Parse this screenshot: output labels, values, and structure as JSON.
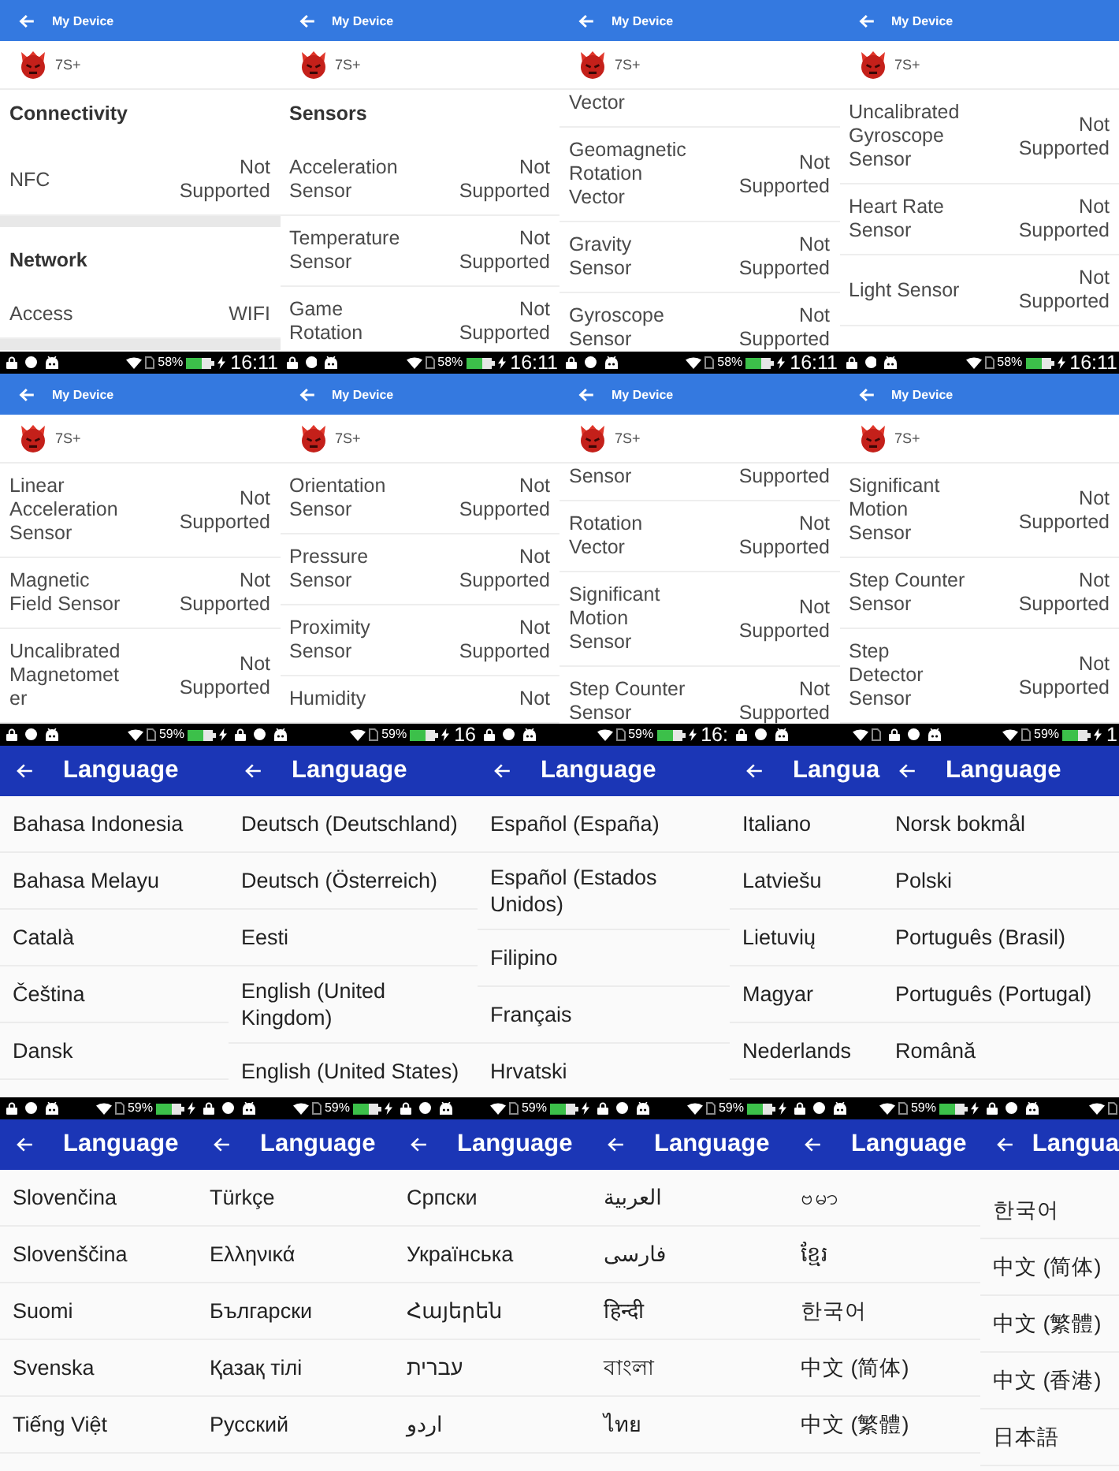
{
  "strips": [
    {
      "screens": [
        {
          "kind": "device",
          "header": {
            "title": "My Device"
          },
          "device": {
            "name": "7S+"
          },
          "entries": [
            {
              "kind": "heading",
              "text": "Connectivity"
            },
            {
              "kind": "row",
              "label": "NFC",
              "value": "Not Supported"
            },
            {
              "kind": "gap"
            },
            {
              "kind": "heading",
              "text": "Network"
            },
            {
              "kind": "row",
              "label": "Access",
              "value": "WIFI"
            },
            {
              "kind": "gap"
            }
          ],
          "status_bar": {
            "battery": "58%",
            "time": "16:11"
          }
        },
        {
          "kind": "device",
          "header": {
            "title": "My Device"
          },
          "device": {
            "name": "7S+"
          },
          "entries": [
            {
              "kind": "heading",
              "text": "Sensors"
            },
            {
              "kind": "row",
              "label": "Acceleration Sensor",
              "value": "Not Supported"
            },
            {
              "kind": "row",
              "label": "Temperature Sensor",
              "value": "Not Supported"
            },
            {
              "kind": "row",
              "label": "Game Rotation",
              "value": "Not Supported"
            }
          ],
          "status_bar": {
            "battery": "58%",
            "time": "16:11"
          }
        },
        {
          "kind": "device",
          "header": {
            "title": "My Device"
          },
          "device": {
            "name": "7S+"
          },
          "entries": [
            {
              "kind": "row",
              "label": "Vector"
            },
            {
              "kind": "row",
              "label": "Geomagnetic Rotation Vector",
              "value": "Not Supported"
            },
            {
              "kind": "row",
              "label": "Gravity Sensor",
              "value": "Not Supported"
            },
            {
              "kind": "row",
              "label": "Gyroscope Sensor",
              "value": "Not Supported"
            }
          ],
          "status_bar": {
            "battery": "58%",
            "time": "16:11"
          }
        },
        {
          "kind": "device",
          "header": {
            "title": "My Device"
          },
          "device": {
            "name": "7S+"
          },
          "entries": [
            {
              "kind": "row",
              "label": "Uncalibrated Gyroscope Sensor",
              "value": "Not Supported"
            },
            {
              "kind": "row",
              "label": "Heart Rate Sensor",
              "value": "Not Supported"
            },
            {
              "kind": "row",
              "label": "Light Sensor",
              "value": "Not Supported"
            }
          ],
          "status_bar": {
            "battery": "58%",
            "time": "16:11"
          }
        }
      ]
    },
    {
      "screens": [
        {
          "kind": "device",
          "header": {
            "title": "My Device"
          },
          "device": {
            "name": "7S+"
          },
          "entries": [
            {
              "kind": "row",
              "label": "Linear Acceleration Sensor",
              "value": "Not Supported"
            },
            {
              "kind": "row",
              "label": "Magnetic Field Sensor",
              "value": "Not Supported"
            },
            {
              "kind": "row",
              "label": "Uncalibrated Magnetometer",
              "value": "Not Supported"
            }
          ]
        },
        {
          "kind": "device",
          "header": {
            "title": "My Device"
          },
          "device": {
            "name": "7S+"
          },
          "entries": [
            {
              "kind": "row",
              "label": "Orientation Sensor",
              "value": "Not Supported"
            },
            {
              "kind": "row",
              "label": "Pressure Sensor",
              "value": "Not Supported"
            },
            {
              "kind": "row",
              "label": "Proximity Sensor",
              "value": "Not Supported"
            },
            {
              "kind": "row",
              "label": "Humidity",
              "value": "Not"
            }
          ]
        },
        {
          "kind": "device",
          "header": {
            "title": "My Device"
          },
          "device": {
            "name": "7S+"
          },
          "entries": [
            {
              "kind": "row",
              "label": "Sensor",
              "value": "Supported"
            },
            {
              "kind": "row",
              "label": "Rotation Vector",
              "value": "Not Supported"
            },
            {
              "kind": "row",
              "label": "Significant Motion Sensor",
              "value": "Not Supported"
            },
            {
              "kind": "row",
              "label": "Step Counter Sensor",
              "value": "Not Supported"
            }
          ]
        },
        {
          "kind": "device",
          "header": {
            "title": "My Device"
          },
          "device": {
            "name": "7S+"
          },
          "entries": [
            {
              "kind": "row",
              "label": "Significant Motion Sensor",
              "value": "Not Supported"
            },
            {
              "kind": "row",
              "label": "Step Counter Sensor",
              "value": "Not Supported"
            },
            {
              "kind": "row",
              "label": "Step Detector Sensor",
              "value": "Not Supported"
            },
            {
              "kind": "gap"
            }
          ]
        }
      ]
    },
    {
      "screens": [
        {
          "kind": "language",
          "status_bar": {
            "battery": "59%"
          },
          "header": {
            "title": "Language"
          },
          "items": [
            "Bahasa Indonesia",
            "Bahasa Melayu",
            "Català",
            "Čeština",
            "Dansk"
          ]
        },
        {
          "kind": "language",
          "status_bar": {
            "battery": "59%",
            "time": "16"
          },
          "header": {
            "title": "Language"
          },
          "items": [
            "Deutsch (Deutschland)",
            "Deutsch (Österreich)",
            "Eesti",
            "English (United Kingdom)",
            "English (United States)"
          ]
        },
        {
          "kind": "language",
          "status_bar": {
            "battery": "59%",
            "time": "16:"
          },
          "header": {
            "title": "Language"
          },
          "items": [
            "Español (España)",
            "Español (Estados Unidos)",
            "Filipino",
            "Français",
            "Hrvatski"
          ]
        },
        {
          "kind": "language",
          "header": {
            "title": "Langua"
          },
          "items": [
            "Italiano",
            "Latviešu",
            "Lietuvių",
            "Magyar",
            "Nederlands"
          ]
        },
        {
          "kind": "language",
          "status_bar": {
            "battery": "59%",
            "time": "1"
          },
          "header": {
            "title": "Language"
          },
          "items": [
            "Norsk bokmål",
            "Polski",
            "Português (Brasil)",
            "Português (Portugal)",
            "Română"
          ]
        }
      ]
    },
    {
      "screens": [
        {
          "kind": "language",
          "status_bar": {
            "battery": "59%"
          },
          "header": {
            "title": "Language"
          },
          "items": [
            "Slovenčina",
            "Slovenščina",
            "Suomi",
            "Svenska",
            "Tiếng Việt"
          ]
        },
        {
          "kind": "language",
          "status_bar": {
            "battery": "59%"
          },
          "header": {
            "title": "Language"
          },
          "items": [
            "Türkçe",
            "Ελληνικά",
            "Български",
            "Қазақ тілі",
            "Русский"
          ]
        },
        {
          "kind": "language",
          "status_bar": {
            "battery": "59%"
          },
          "header": {
            "title": "Language"
          },
          "items": [
            "Српски",
            "Українська",
            "Հայերեն",
            "עברית",
            "اردو"
          ]
        },
        {
          "kind": "language",
          "status_bar": {
            "battery": "59%"
          },
          "header": {
            "title": "Language"
          },
          "items": [
            "العربية",
            "فارسی",
            "हिन्दी",
            "বাংলা",
            "ไทย"
          ]
        },
        {
          "kind": "language",
          "status_bar": {
            "battery": "59%"
          },
          "header": {
            "title": "Language"
          },
          "items": [
            "ဗမာ",
            "ខ្មែរ",
            "한국어",
            "中文 (简体)",
            "中文 (繁體)"
          ]
        },
        {
          "kind": "language",
          "header": {
            "title": "Langua"
          },
          "items": [
            "한국어",
            "中文 (简体)",
            "中文 (繁體)",
            "中文 (香港)",
            "日本語"
          ]
        }
      ]
    }
  ]
}
